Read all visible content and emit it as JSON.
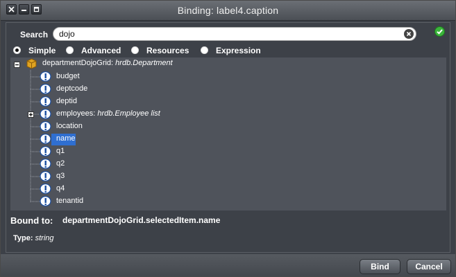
{
  "window": {
    "title": "Binding: label4.caption",
    "controls": [
      "close-icon",
      "minimize-icon",
      "maximize-icon"
    ]
  },
  "search": {
    "label": "Search",
    "value": "dojo"
  },
  "modes": {
    "selected": "Simple",
    "options": [
      "Simple",
      "Advanced",
      "Resources",
      "Expression"
    ]
  },
  "tree": {
    "root": {
      "name": "departmentDojoGrid:",
      "type": "hrdb.Department",
      "expanded": true
    },
    "items": [
      {
        "name": "budget",
        "type": ""
      },
      {
        "name": "deptcode",
        "type": ""
      },
      {
        "name": "deptid",
        "type": ""
      },
      {
        "name": "employees:",
        "type": "hrdb.Employee list",
        "expandable": true
      },
      {
        "name": "location",
        "type": ""
      },
      {
        "name": "name",
        "type": "",
        "selected": true
      },
      {
        "name": "q1",
        "type": ""
      },
      {
        "name": "q2",
        "type": ""
      },
      {
        "name": "q3",
        "type": ""
      },
      {
        "name": "q4",
        "type": ""
      },
      {
        "name": "tenantid",
        "type": ""
      }
    ]
  },
  "bound": {
    "label": "Bound to:",
    "value": "departmentDojoGrid.selectedItem.name"
  },
  "type_info": {
    "label": "Type:",
    "value": "string"
  },
  "buttons": {
    "bind": "Bind",
    "cancel": "Cancel"
  },
  "colors": {
    "selection": "#2f6fd1",
    "tree_bg": "#4f535b",
    "panel_bg": "#3d4148",
    "ok_green": "#3bb53b"
  }
}
